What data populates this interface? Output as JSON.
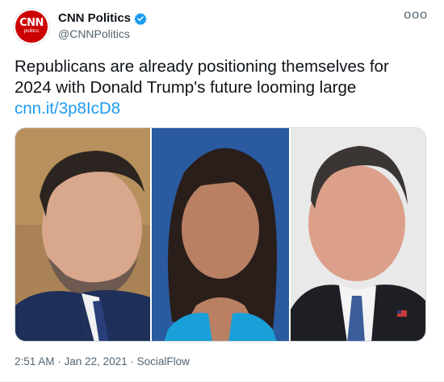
{
  "account": {
    "avatar_text": "CNN",
    "avatar_subtext": "politics",
    "name": "CNN Politics",
    "handle": "@CNNPolitics",
    "more_label": "ooo"
  },
  "tweet": {
    "text": "Republicans are already positioning themselves for 2024 with Donald Trump's future looming large",
    "link": "cnn.it/3p8IcD8"
  },
  "meta": {
    "timestamp": "2:51 AM · Jan 22, 2021 · SocialFlow"
  },
  "colors": {
    "accent": "#1d9bf0",
    "brand": "#cc0000"
  },
  "icons": {
    "verified": "verified-badge-icon",
    "more": "more-options-icon"
  }
}
